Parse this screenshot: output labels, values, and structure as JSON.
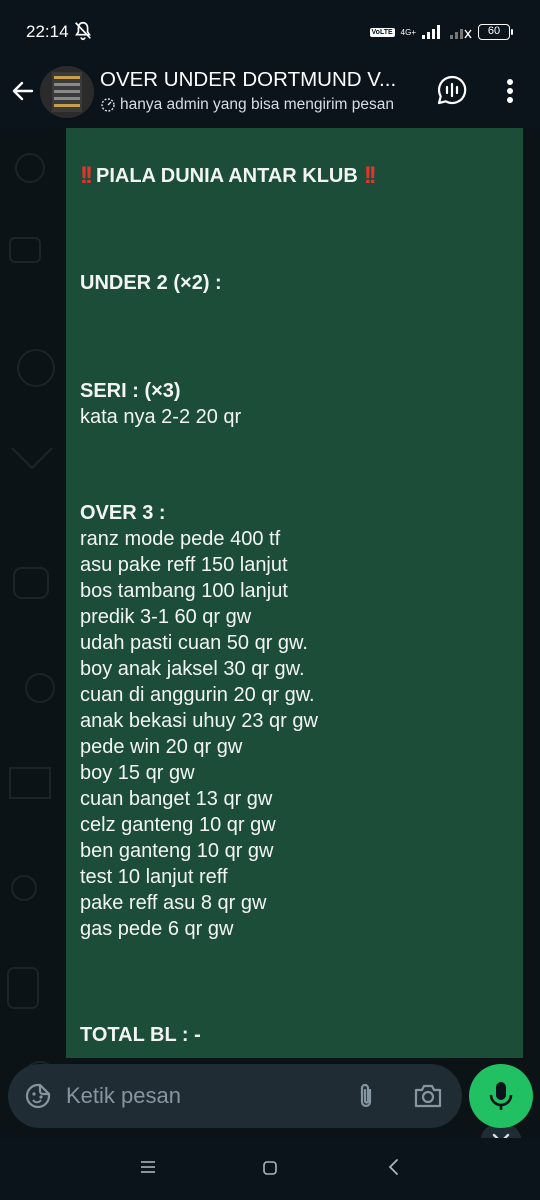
{
  "status_bar": {
    "time": "22:14",
    "volte": "VoLTE",
    "network": "4G+",
    "battery": "60"
  },
  "header": {
    "title": "OVER UNDER DORTMUND V...",
    "subtitle": "hanya admin yang bisa mengirim pesan"
  },
  "message": {
    "title": "PIALA DUNIA ANTAR KLUB",
    "lines": [
      {
        "text": "UNDER 2 (×2) :",
        "bold": true
      },
      {
        "text": "SERI : (×3)",
        "bold": true
      },
      {
        "text": "kata nya 2-2 20 qr",
        "bold": false
      },
      {
        "text": "OVER 3 :",
        "bold": true
      },
      {
        "text": "ranz mode pede 400 tf",
        "bold": false
      },
      {
        "text": "asu pake reff 150 lanjut",
        "bold": false
      },
      {
        "text": "bos tambang 100 lanjut",
        "bold": false
      },
      {
        "text": "predik 3-1 60 qr gw",
        "bold": false
      },
      {
        "text": "udah pasti cuan 50 qr gw.",
        "bold": false
      },
      {
        "text": "boy anak jaksel 30 qr gw.",
        "bold": false
      },
      {
        "text": "cuan di anggurin 20 qr gw.",
        "bold": false
      },
      {
        "text": "anak bekasi uhuy 23 qr gw",
        "bold": false
      },
      {
        "text": "pede win 20 qr gw",
        "bold": false
      },
      {
        "text": "boy 15 qr gw",
        "bold": false
      },
      {
        "text": "cuan banget 13 qr gw",
        "bold": false
      },
      {
        "text": "celz ganteng 10 qr gw",
        "bold": false
      },
      {
        "text": "ben ganteng 10 qr gw",
        "bold": false
      },
      {
        "text": "test 10 lanjut reff",
        "bold": false
      },
      {
        "text": "pake reff asu 8 qr gw",
        "bold": false
      },
      {
        "text": "gas pede 6 qr gw",
        "bold": false
      },
      {
        "text": "TOTAL BL : -",
        "bold": true
      }
    ]
  },
  "input": {
    "placeholder": "Ketik pesan"
  },
  "colors": {
    "bubble": "#1b4d39",
    "accent_green": "#21c063",
    "background": "#0b141a"
  },
  "icons": {
    "back": "back-arrow-icon",
    "voice_chat": "voice-chat-icon",
    "menu": "more-vert-icon",
    "scroll_down": "double-chevron-down-icon",
    "emoji": "sticker-icon",
    "attach": "paperclip-icon",
    "camera": "camera-icon",
    "mic": "mic-icon"
  }
}
